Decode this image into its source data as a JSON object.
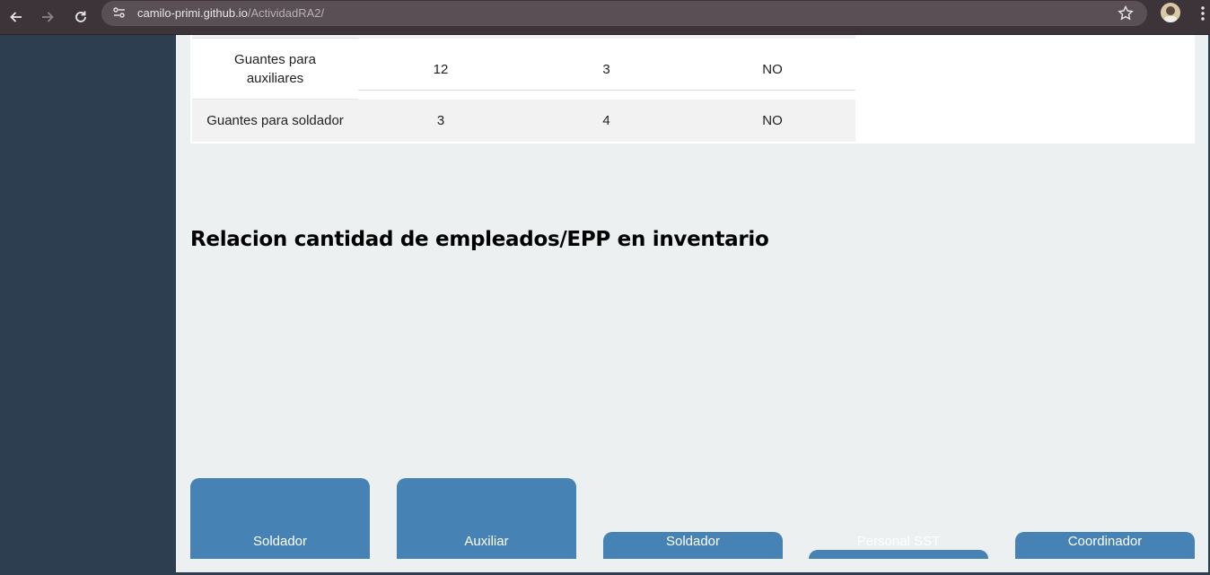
{
  "browser": {
    "url_host": "camilo-primi.github.io",
    "url_path": "/ActividadRA2/"
  },
  "table": {
    "rows": [
      {
        "item": "Guantes para auxiliares",
        "col1": "12",
        "col2": "3",
        "col3": "NO"
      },
      {
        "item": "Guantes para soldador",
        "col1": "3",
        "col2": "4",
        "col3": "NO"
      }
    ]
  },
  "section": {
    "title": "Relacion cantidad de empleados/EPP en inventario"
  },
  "chart_data": {
    "type": "bar",
    "categories": [
      "Soldador",
      "Auxiliar",
      "Soldador",
      "Personal SST",
      "Coordinador"
    ],
    "title": "",
    "colors": {
      "bar": "#4682b4",
      "label": "#ffffff"
    }
  },
  "colors": {
    "sidebar": "#2c3e50",
    "background": "#ecf0f1",
    "accent": "#4682b4"
  }
}
